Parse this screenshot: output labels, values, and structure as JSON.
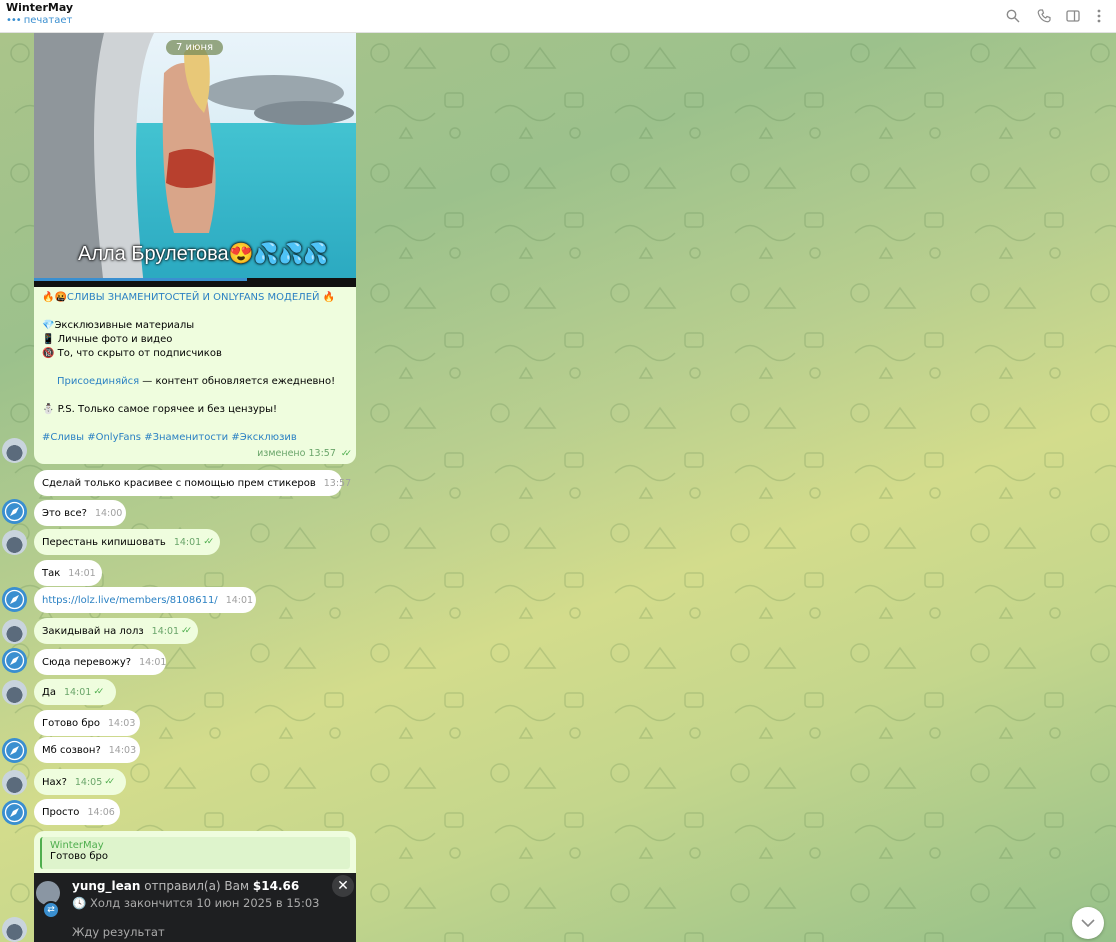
{
  "header": {
    "title": "WinterMay",
    "status": "печатает",
    "icons": [
      "search-icon",
      "phone-icon",
      "sidebar-toggle-icon",
      "more-icon"
    ]
  },
  "colors": {
    "accent": "#3a8fd0",
    "outgoing_bubble": "#effdde",
    "incoming_bubble": "#ffffff",
    "read_check": "#4fae4e"
  },
  "media": {
    "date": "7 июня",
    "overlay_text": "Алла Брулетова😍💦💦💦",
    "progress": 0.66
  },
  "caption": {
    "heading": "🔥🤬СЛИВЫ ЗНАМЕНИТОСТЕЙ И ONLYFANS МОДЕЛЕЙ 🔥",
    "items": [
      "💎Эксклюзивные материалы",
      "📱 Личные фото и видео",
      "🔞 То, что скрыто от подписчиков"
    ],
    "join_link": "Присоединяйся",
    "join_rest": " — контент обновляется ежедневно!",
    "ps": "⛄ P.S. Только самое горячее и без цензуры!",
    "hashtags": "#Сливы #OnlyFans #Знаменитости #Эксклюзив",
    "edited": "изменено",
    "time": "13:57"
  },
  "messages": [
    {
      "text": "Сделай только красивее с помощью прем стикеров",
      "time": "13:57"
    },
    {
      "text": "Это все?",
      "time": "14:00"
    },
    {
      "text": "Перестань кипишовать",
      "time": "14:01"
    },
    {
      "text": "Так",
      "time": "14:01"
    },
    {
      "text": "https://lolz.live/members/8108611/",
      "time": "14:01"
    },
    {
      "text": "Закидывай на лолз",
      "time": "14:01"
    },
    {
      "text": "Сюда перевожу?",
      "time": "14:01"
    },
    {
      "text": "Да",
      "time": "14:01"
    },
    {
      "text": "Готово бро",
      "time": "14:03"
    },
    {
      "text": "Мб созвон?",
      "time": "14:03"
    },
    {
      "text": "Нах?",
      "time": "14:05"
    },
    {
      "text": "Просто",
      "time": "14:06"
    }
  ],
  "reply": {
    "quote_name": "WinterMay",
    "quote_text": "Готово бро"
  },
  "payment": {
    "sender": "yung_lean",
    "action": " отправил(а) Вам ",
    "amount": "$14.66",
    "hold": "Холд закончится 10 июн 2025 в 15:03",
    "note": "Жду результат",
    "close": "✕"
  }
}
